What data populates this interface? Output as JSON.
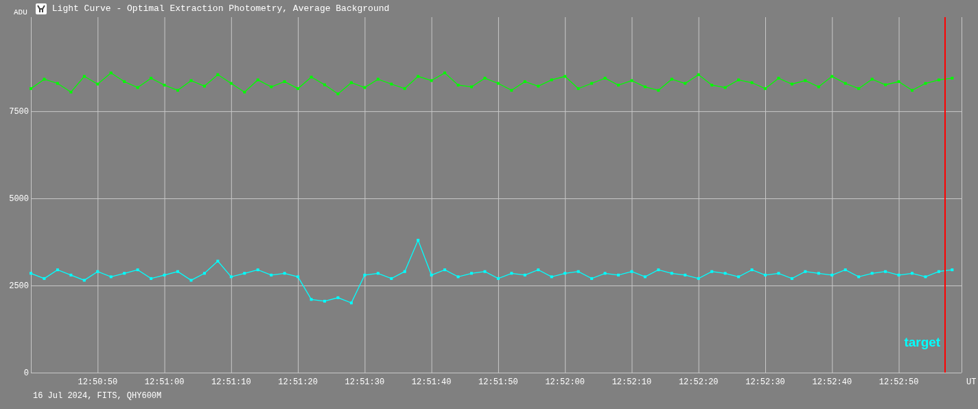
{
  "window": {
    "title": "Light Curve - Optimal Extraction Photometry, Average Background"
  },
  "chart": {
    "chart_data": {
      "type": "line",
      "xlabel": "UT",
      "ylabel": "ADU",
      "categories": [
        null,
        null,
        null,
        null,
        null,
        "12:50:50",
        null,
        null,
        null,
        null,
        "12:51:00",
        null,
        null,
        null,
        null,
        "12:51:10",
        null,
        null,
        null,
        null,
        "12:51:20",
        null,
        null,
        null,
        null,
        "12:51:30",
        null,
        null,
        null,
        null,
        "12:51:40",
        null,
        null,
        null,
        null,
        "12:51:50",
        null,
        null,
        null,
        null,
        "12:52:00",
        null,
        null,
        null,
        null,
        "12:52:10",
        null,
        null,
        null,
        null,
        "12:52:20",
        null,
        null,
        null,
        null,
        "12:52:30",
        null,
        null,
        null,
        null,
        "12:52:40",
        null,
        null,
        null,
        null,
        "12:52:50",
        null,
        null,
        null,
        null
      ],
      "series": [
        {
          "color": "#00ff00",
          "marker": "square",
          "values": [
            8150,
            8420,
            8300,
            8050,
            8500,
            8280,
            8600,
            8350,
            8180,
            8450,
            8250,
            8100,
            8380,
            8220,
            8550,
            8300,
            8050,
            8400,
            8200,
            8350,
            8150,
            8480,
            8260,
            8000,
            8320,
            8180,
            8420,
            8280,
            8150,
            8500,
            8380,
            8600,
            8250,
            8200,
            8450,
            8300,
            8100,
            8350,
            8220,
            8400,
            8500,
            8150,
            8300,
            8450,
            8250,
            8380,
            8200,
            8100,
            8420,
            8300,
            8550,
            8250,
            8180,
            8400,
            8320,
            8150,
            8450,
            8280,
            8380,
            8200,
            8500,
            8300,
            8150,
            8420,
            8260,
            8350,
            8100,
            8300,
            8400,
            8450
          ]
        },
        {
          "name": "target",
          "color": "#00ffff",
          "marker": "square",
          "values": [
            2850,
            2700,
            2950,
            2800,
            2650,
            2900,
            2750,
            2850,
            2950,
            2700,
            2800,
            2900,
            2650,
            2850,
            3200,
            2750,
            2850,
            2950,
            2800,
            2850,
            2750,
            2100,
            2050,
            2150,
            2000,
            2800,
            2850,
            2700,
            2900,
            3800,
            2800,
            2950,
            2750,
            2850,
            2900,
            2700,
            2850,
            2800,
            2950,
            2750,
            2850,
            2900,
            2700,
            2850,
            2800,
            2900,
            2750,
            2950,
            2850,
            2800,
            2700,
            2900,
            2850,
            2750,
            2950,
            2800,
            2850,
            2700,
            2900,
            2850,
            2800,
            2950,
            2750,
            2850,
            2900,
            2800,
            2850,
            2750,
            2900,
            2950
          ]
        }
      ],
      "ylim": [
        0,
        10200
      ],
      "grid": true,
      "yticks": [
        0,
        2500,
        5000,
        7500
      ]
    }
  },
  "caption": "16 Jul 2024, FITS, QHY600M"
}
